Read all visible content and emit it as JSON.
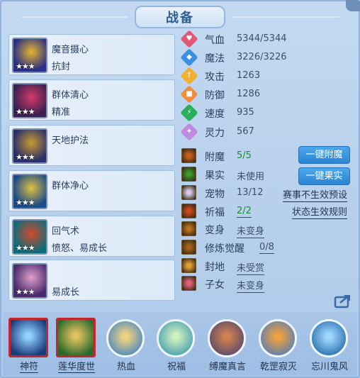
{
  "title": "战备",
  "skills": [
    {
      "name": "魔音摄心",
      "desc": "抗封",
      "stars": "★★★",
      "colors": [
        "#2a2f8a",
        "#e5b52a"
      ]
    },
    {
      "name": "群体清心",
      "desc": "精准",
      "stars": "★★★",
      "colors": [
        "#3a1f4f",
        "#d23a6a"
      ]
    },
    {
      "name": "天地护法",
      "desc": "",
      "stars": "★★★",
      "colors": [
        "#2b2f6a",
        "#c99a2f"
      ]
    },
    {
      "name": "群体净心",
      "desc": "",
      "stars": "★★★",
      "colors": [
        "#1a4a8a",
        "#e0c040"
      ]
    },
    {
      "name": "回气术",
      "desc": "愤怒、易成长",
      "stars": "★★★",
      "colors": [
        "#0e6c7a",
        "#d24a2a"
      ]
    },
    {
      "name": "",
      "desc": "易成长",
      "stars": "★★★",
      "colors": [
        "#4a2a6a",
        "#e0a0d0"
      ]
    }
  ],
  "stats": [
    {
      "label": "气血",
      "value": "5344/5344",
      "color": "#e05a78",
      "icon": "heart-icon"
    },
    {
      "label": "魔法",
      "value": "3226/3226",
      "color": "#3a8fe0",
      "icon": "mana-icon"
    },
    {
      "label": "攻击",
      "value": "1263",
      "color": "#f0b030",
      "icon": "attack-icon"
    },
    {
      "label": "防御",
      "value": "1286",
      "color": "#f08c3a",
      "icon": "shield-icon"
    },
    {
      "label": "速度",
      "value": "935",
      "color": "#2aae5a",
      "icon": "speed-icon"
    },
    {
      "label": "灵力",
      "value": "567",
      "color": "#c08ae0",
      "icon": "spirit-icon"
    }
  ],
  "equip": [
    {
      "label": "附魔",
      "value": "5/5",
      "style": "green",
      "icon": "enchant-icon",
      "color": "#c4601a"
    },
    {
      "label": "果实",
      "value": "未使用",
      "style": "",
      "icon": "fruit-icon",
      "color": "#3a9a2a"
    },
    {
      "label": "宠物",
      "value": "13/12",
      "style": "",
      "icon": "pet-icon",
      "color": "#d8c8e8"
    },
    {
      "label": "祈福",
      "value": "2/2",
      "style": "green ul",
      "icon": "pray-icon",
      "color": "#c84a1a"
    },
    {
      "label": "变身",
      "value": "未变身",
      "style": "ul",
      "icon": "transform-icon",
      "color": "#b8701a"
    },
    {
      "label": "修炼觉醒",
      "value": "0/8",
      "style": "ul",
      "icon": "awaken-icon",
      "color": "#a8601a"
    },
    {
      "label": "封地",
      "value": "未受赏",
      "style": "ul",
      "icon": "fief-icon",
      "color": "#e0a030"
    },
    {
      "label": "子女",
      "value": "未变身",
      "style": "ul",
      "icon": "child-icon",
      "color": "#e0607a"
    }
  ],
  "buttons": {
    "enchant": "一键附魔",
    "fruit": "一键果实"
  },
  "links": {
    "preset": "赛事不生效预设",
    "rules": "状态生效规则"
  },
  "bottom_skills": [
    {
      "label": "神符",
      "framed": true,
      "colors": [
        "#1a3a7a",
        "#8fd0ff"
      ]
    },
    {
      "label": "莲华度世",
      "framed": true,
      "colors": [
        "#2a6a2a",
        "#e0c060"
      ]
    },
    {
      "label": "热血",
      "framed": false,
      "colors": [
        "#4a8ac0",
        "#f0d080"
      ]
    },
    {
      "label": "祝福",
      "framed": false,
      "colors": [
        "#4aa0b0",
        "#d0f0c0"
      ]
    },
    {
      "label": "缚魔真言",
      "framed": false,
      "colors": [
        "#5a4a6a",
        "#d08050"
      ]
    },
    {
      "label": "乾罡寂灭",
      "framed": false,
      "colors": [
        "#5a80b0",
        "#f0a040"
      ]
    },
    {
      "label": "忘川鬼风",
      "framed": false,
      "colors": [
        "#2a70b0",
        "#a0d8ff"
      ]
    }
  ]
}
